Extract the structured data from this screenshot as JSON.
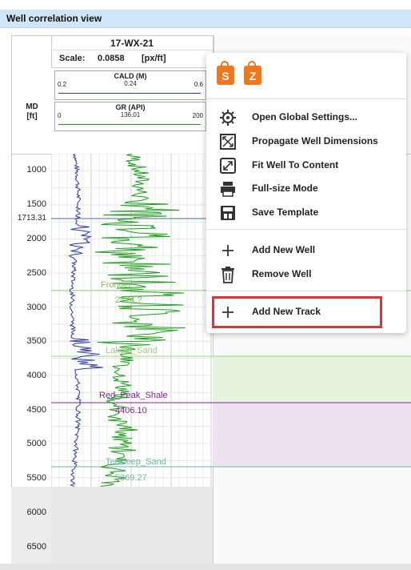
{
  "window": {
    "title": "Well correlation view"
  },
  "well": {
    "name": "17-WX-21",
    "scale_label": "Scale:",
    "scale_value": "0.0858",
    "scale_unit": "[px/ft]"
  },
  "tracks": [
    {
      "name": "CALD (M)",
      "current": "0.24",
      "min": "0.2",
      "max": "0.6",
      "color": "#2b3aa8"
    },
    {
      "name": "GR (API)",
      "current": "136.01",
      "min": "0",
      "max": "200",
      "color": "#1a9e1a"
    }
  ],
  "depth_axis": {
    "label": "MD\n[ft]",
    "label_line1": "MD",
    "label_line2": "[ft]",
    "ticks": [
      "1000",
      "1500",
      "1713.31",
      "2000",
      "2500",
      "3000",
      "3500",
      "4000",
      "4500",
      "5000",
      "5500",
      "6000",
      "6500"
    ]
  },
  "formation_tops": [
    {
      "name": "Frontier",
      "depth": "2774.?",
      "color": "#7ec45a"
    },
    {
      "name": "Lakota_Sand",
      "depth": "",
      "color": "#9fd07d"
    },
    {
      "name": "Red_Peak_Shale",
      "depth": "4406.10",
      "color": "#7b2a8b"
    },
    {
      "name": "Tensleep_Sand",
      "depth": "5369.27",
      "color": "#6fb7a8"
    }
  ],
  "formation_labels": {
    "frontier": "Frontier",
    "frontier_depth": "2774.?",
    "lakota": "Lakota_Sand",
    "red_peak": "Red_Peak_Shale",
    "red_peak_depth": "4406.10",
    "tensleep": "Tensleep_Sand",
    "tensleep_depth": "5369.27"
  },
  "context_menu": {
    "items": [
      {
        "label": "Open Global Settings...",
        "icon": "gear-icon"
      },
      {
        "label": "Propagate Well Dimensions",
        "icon": "expand-frame-icon"
      },
      {
        "label": "Fit Well To Content",
        "icon": "fit-diagonal-icon"
      },
      {
        "label": "Full-size Mode",
        "icon": "printer-icon"
      },
      {
        "label": "Save Template",
        "icon": "save-template-icon"
      },
      {
        "label": "Add New Well",
        "icon": "plus-icon"
      },
      {
        "label": "Remove Well",
        "icon": "trash-icon"
      },
      {
        "label": "Add New Track",
        "icon": "plus-icon"
      }
    ],
    "app_icons": [
      {
        "letter": "S",
        "icon": "lock-s-icon"
      },
      {
        "letter": "Z",
        "icon": "lock-z-icon"
      }
    ]
  },
  "colors": {
    "accent": "#f2761c",
    "highlight": "#e53030",
    "title_bg": "#cfe5f8"
  }
}
